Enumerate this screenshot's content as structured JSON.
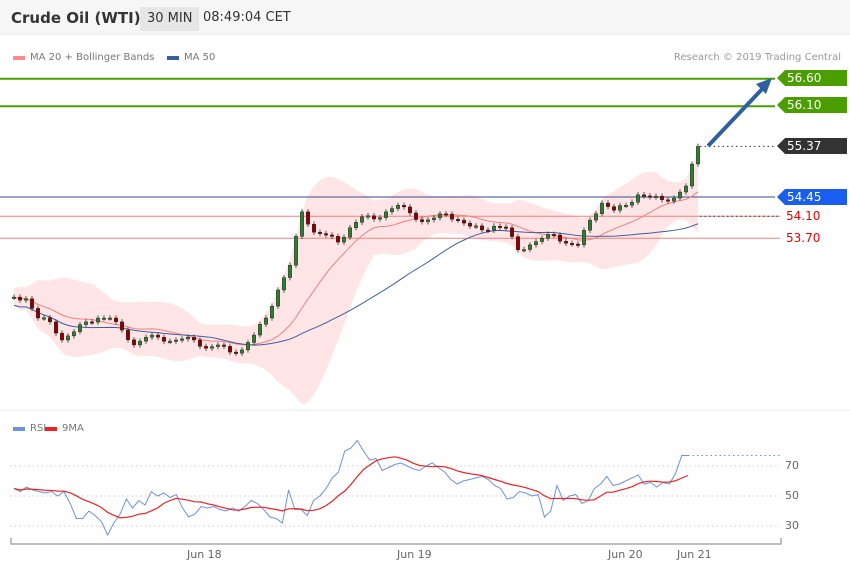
{
  "header": {
    "title": "Crude Oil (WTI)",
    "timeframe": "30 MIN",
    "time": "08:49:04 CET"
  },
  "legend": {
    "ma20": "MA 20 + Bollinger Bands",
    "ma50": "MA 50",
    "rsi": "RSI",
    "ma9": "9MA"
  },
  "copyright": "Research © 2019 Trading Central",
  "levels": {
    "r2": "56.60",
    "r1": "56.10",
    "last": "55.37",
    "pivot": "54.45",
    "s1": "54.10",
    "s2": "53.70"
  },
  "colors": {
    "resistance": "#4a9e00",
    "last": "#333333",
    "pivot": "#1a5ef0",
    "support": "#ee0000",
    "up": "#2e7d32",
    "down": "#8b0000",
    "ma20": "#f08080",
    "ma50": "#3a5fa0",
    "rsi": "#7090e0",
    "ma9": "#ee2222"
  },
  "chart_data": {
    "type": "line",
    "price": {
      "closes": [
        52.63,
        52.6,
        52.25,
        52.18,
        51.85,
        52.0,
        52.18,
        52.25,
        52.25,
        52.03,
        51.76,
        51.9,
        51.9,
        51.83,
        51.87,
        51.85,
        51.7,
        51.76,
        51.63,
        51.67,
        51.94,
        52.25,
        52.76,
        53.21,
        54.18,
        53.81,
        53.76,
        53.63,
        53.89,
        54.09,
        54.05,
        54.18,
        54.3,
        54.16,
        54.0,
        54.07,
        54.14,
        54.03,
        53.92,
        53.85,
        53.92,
        53.89,
        53.49,
        53.58,
        53.7,
        53.76,
        53.61,
        53.58,
        54.03,
        54.34,
        54.21,
        54.3,
        54.49,
        54.45,
        54.4,
        54.43,
        54.65,
        55.37
      ],
      "levels": [
        56.6,
        56.1,
        55.37,
        54.45,
        54.1,
        53.7
      ],
      "target": 56.6
    },
    "rsi": {
      "values": [
        55,
        53,
        56,
        54,
        53,
        52,
        53,
        50,
        53,
        45,
        35,
        35,
        40,
        37,
        33,
        24,
        32,
        38,
        48,
        42,
        47,
        44,
        53,
        50,
        52,
        49,
        51,
        42,
        36,
        38,
        43,
        42,
        43,
        41,
        40,
        42,
        40,
        43,
        47,
        45,
        41,
        36,
        35,
        32,
        54,
        41,
        41,
        37,
        47,
        50,
        55,
        62,
        66,
        80,
        82,
        87,
        80,
        74,
        75,
        67,
        69,
        71,
        72,
        70,
        68,
        67,
        70,
        72,
        69,
        66,
        61,
        58,
        60,
        61,
        62,
        63,
        61,
        57,
        55,
        48,
        49,
        53,
        52,
        50,
        51,
        36,
        40,
        57,
        47,
        50,
        51,
        45,
        47,
        55,
        58,
        63,
        57,
        58,
        60,
        62,
        64,
        58,
        59,
        56,
        59,
        58,
        65,
        77,
        77
      ],
      "yticks": [
        "70",
        "50",
        "30"
      ]
    },
    "xticks": [
      "Jun 18",
      "Jun 19",
      "Jun 20",
      "Jun 21"
    ]
  }
}
